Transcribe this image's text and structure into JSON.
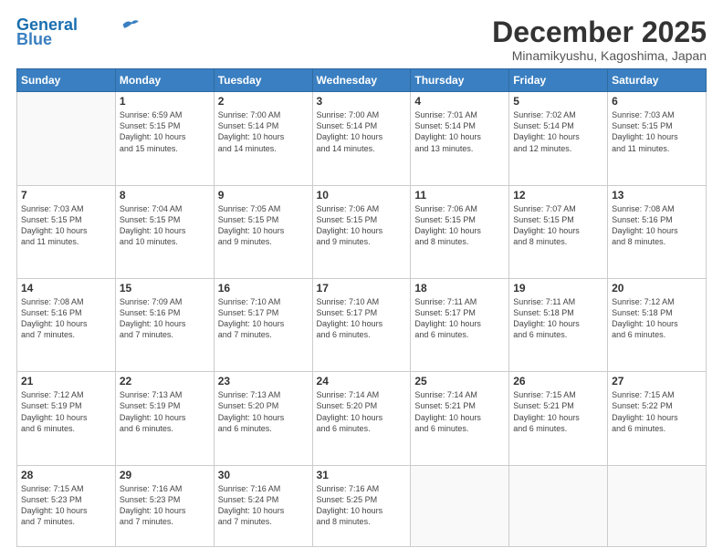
{
  "header": {
    "logo_line1": "General",
    "logo_line2": "Blue",
    "month": "December 2025",
    "location": "Minamikyushu, Kagoshima, Japan"
  },
  "weekdays": [
    "Sunday",
    "Monday",
    "Tuesday",
    "Wednesday",
    "Thursday",
    "Friday",
    "Saturday"
  ],
  "weeks": [
    [
      {
        "day": "",
        "info": ""
      },
      {
        "day": "1",
        "info": "Sunrise: 6:59 AM\nSunset: 5:15 PM\nDaylight: 10 hours\nand 15 minutes."
      },
      {
        "day": "2",
        "info": "Sunrise: 7:00 AM\nSunset: 5:14 PM\nDaylight: 10 hours\nand 14 minutes."
      },
      {
        "day": "3",
        "info": "Sunrise: 7:00 AM\nSunset: 5:14 PM\nDaylight: 10 hours\nand 14 minutes."
      },
      {
        "day": "4",
        "info": "Sunrise: 7:01 AM\nSunset: 5:14 PM\nDaylight: 10 hours\nand 13 minutes."
      },
      {
        "day": "5",
        "info": "Sunrise: 7:02 AM\nSunset: 5:14 PM\nDaylight: 10 hours\nand 12 minutes."
      },
      {
        "day": "6",
        "info": "Sunrise: 7:03 AM\nSunset: 5:15 PM\nDaylight: 10 hours\nand 11 minutes."
      }
    ],
    [
      {
        "day": "7",
        "info": "Sunrise: 7:03 AM\nSunset: 5:15 PM\nDaylight: 10 hours\nand 11 minutes."
      },
      {
        "day": "8",
        "info": "Sunrise: 7:04 AM\nSunset: 5:15 PM\nDaylight: 10 hours\nand 10 minutes."
      },
      {
        "day": "9",
        "info": "Sunrise: 7:05 AM\nSunset: 5:15 PM\nDaylight: 10 hours\nand 9 minutes."
      },
      {
        "day": "10",
        "info": "Sunrise: 7:06 AM\nSunset: 5:15 PM\nDaylight: 10 hours\nand 9 minutes."
      },
      {
        "day": "11",
        "info": "Sunrise: 7:06 AM\nSunset: 5:15 PM\nDaylight: 10 hours\nand 8 minutes."
      },
      {
        "day": "12",
        "info": "Sunrise: 7:07 AM\nSunset: 5:15 PM\nDaylight: 10 hours\nand 8 minutes."
      },
      {
        "day": "13",
        "info": "Sunrise: 7:08 AM\nSunset: 5:16 PM\nDaylight: 10 hours\nand 8 minutes."
      }
    ],
    [
      {
        "day": "14",
        "info": "Sunrise: 7:08 AM\nSunset: 5:16 PM\nDaylight: 10 hours\nand 7 minutes."
      },
      {
        "day": "15",
        "info": "Sunrise: 7:09 AM\nSunset: 5:16 PM\nDaylight: 10 hours\nand 7 minutes."
      },
      {
        "day": "16",
        "info": "Sunrise: 7:10 AM\nSunset: 5:17 PM\nDaylight: 10 hours\nand 7 minutes."
      },
      {
        "day": "17",
        "info": "Sunrise: 7:10 AM\nSunset: 5:17 PM\nDaylight: 10 hours\nand 6 minutes."
      },
      {
        "day": "18",
        "info": "Sunrise: 7:11 AM\nSunset: 5:17 PM\nDaylight: 10 hours\nand 6 minutes."
      },
      {
        "day": "19",
        "info": "Sunrise: 7:11 AM\nSunset: 5:18 PM\nDaylight: 10 hours\nand 6 minutes."
      },
      {
        "day": "20",
        "info": "Sunrise: 7:12 AM\nSunset: 5:18 PM\nDaylight: 10 hours\nand 6 minutes."
      }
    ],
    [
      {
        "day": "21",
        "info": "Sunrise: 7:12 AM\nSunset: 5:19 PM\nDaylight: 10 hours\nand 6 minutes."
      },
      {
        "day": "22",
        "info": "Sunrise: 7:13 AM\nSunset: 5:19 PM\nDaylight: 10 hours\nand 6 minutes."
      },
      {
        "day": "23",
        "info": "Sunrise: 7:13 AM\nSunset: 5:20 PM\nDaylight: 10 hours\nand 6 minutes."
      },
      {
        "day": "24",
        "info": "Sunrise: 7:14 AM\nSunset: 5:20 PM\nDaylight: 10 hours\nand 6 minutes."
      },
      {
        "day": "25",
        "info": "Sunrise: 7:14 AM\nSunset: 5:21 PM\nDaylight: 10 hours\nand 6 minutes."
      },
      {
        "day": "26",
        "info": "Sunrise: 7:15 AM\nSunset: 5:21 PM\nDaylight: 10 hours\nand 6 minutes."
      },
      {
        "day": "27",
        "info": "Sunrise: 7:15 AM\nSunset: 5:22 PM\nDaylight: 10 hours\nand 6 minutes."
      }
    ],
    [
      {
        "day": "28",
        "info": "Sunrise: 7:15 AM\nSunset: 5:23 PM\nDaylight: 10 hours\nand 7 minutes."
      },
      {
        "day": "29",
        "info": "Sunrise: 7:16 AM\nSunset: 5:23 PM\nDaylight: 10 hours\nand 7 minutes."
      },
      {
        "day": "30",
        "info": "Sunrise: 7:16 AM\nSunset: 5:24 PM\nDaylight: 10 hours\nand 7 minutes."
      },
      {
        "day": "31",
        "info": "Sunrise: 7:16 AM\nSunset: 5:25 PM\nDaylight: 10 hours\nand 8 minutes."
      },
      {
        "day": "",
        "info": ""
      },
      {
        "day": "",
        "info": ""
      },
      {
        "day": "",
        "info": ""
      }
    ]
  ]
}
